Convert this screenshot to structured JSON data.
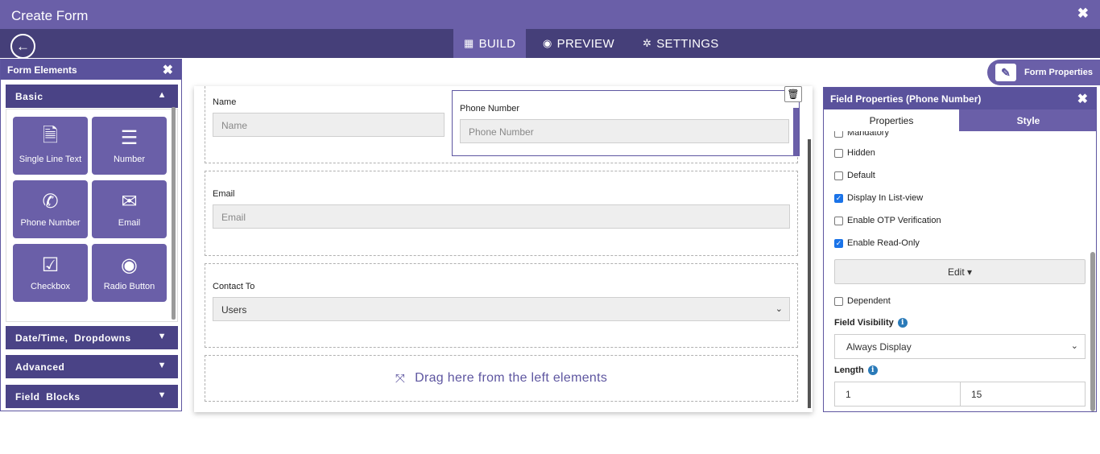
{
  "window": {
    "title": "Create Form",
    "close": "✖"
  },
  "nav": {
    "back": "←",
    "tabs": [
      {
        "label": "BUILD",
        "icon": "calculator-icon",
        "glyph": "▦"
      },
      {
        "label": "PREVIEW",
        "icon": "eye-icon",
        "glyph": "◉"
      },
      {
        "label": "SETTINGS",
        "icon": "gear-icon",
        "glyph": "✲"
      }
    ]
  },
  "left_panel": {
    "title": "Form Elements",
    "close": "✖",
    "sections": [
      {
        "label": "Basic",
        "expanded": true,
        "chevron": "▲"
      },
      {
        "label": "Date/Time,  Dropdowns",
        "expanded": false,
        "chevron": "▼"
      },
      {
        "label": "Advanced",
        "expanded": false,
        "chevron": "▼"
      },
      {
        "label": "Field  Blocks",
        "expanded": false,
        "chevron": "▼"
      }
    ],
    "tiles": [
      {
        "label": "Single Line Text",
        "icon": "document-icon",
        "glyph": "🗎"
      },
      {
        "label": "Number",
        "icon": "numbered-list-icon",
        "glyph": "☰"
      },
      {
        "label": "Phone Number",
        "icon": "phone-icon",
        "glyph": "✆"
      },
      {
        "label": "Email",
        "icon": "envelope-icon",
        "glyph": "✉"
      },
      {
        "label": "Checkbox",
        "icon": "checkbox-icon",
        "glyph": "☑"
      },
      {
        "label": "Radio Button",
        "icon": "radio-icon",
        "glyph": "◉"
      }
    ]
  },
  "canvas": {
    "name": {
      "label": "Name",
      "placeholder": "Name"
    },
    "phone": {
      "label": "Phone Number",
      "placeholder": "Phone Number"
    },
    "email": {
      "label": "Email",
      "placeholder": "Email"
    },
    "contact": {
      "label": "Contact To",
      "value": "Users",
      "caret": "⌄"
    },
    "drag_hint": "Drag here from the left elements",
    "drag_icon": "⤧",
    "trash_glyph": "🗑"
  },
  "form_properties": {
    "label": "Form Properties",
    "glyph": "✎"
  },
  "field_properties": {
    "title": "Field Properties (Phone Number)",
    "close": "✖",
    "tabs": {
      "properties": "Properties",
      "style": "Style"
    },
    "checkboxes": [
      {
        "label": "Mandatory",
        "checked": false
      },
      {
        "label": "Hidden",
        "checked": false
      },
      {
        "label": "Default",
        "checked": false
      },
      {
        "label": "Display In List-view",
        "checked": true
      },
      {
        "label": "Enable OTP Verification",
        "checked": false
      },
      {
        "label": "Enable Read-Only",
        "checked": true
      }
    ],
    "edit_button": "Edit ▾",
    "dependent": {
      "label": "Dependent",
      "checked": false
    },
    "field_visibility": {
      "label": "Field Visibility",
      "value": "Always Display",
      "caret": "⌄"
    },
    "length": {
      "label": "Length",
      "min": "1",
      "max": "15"
    },
    "info_glyph": "i",
    "check_glyph": "✓"
  }
}
